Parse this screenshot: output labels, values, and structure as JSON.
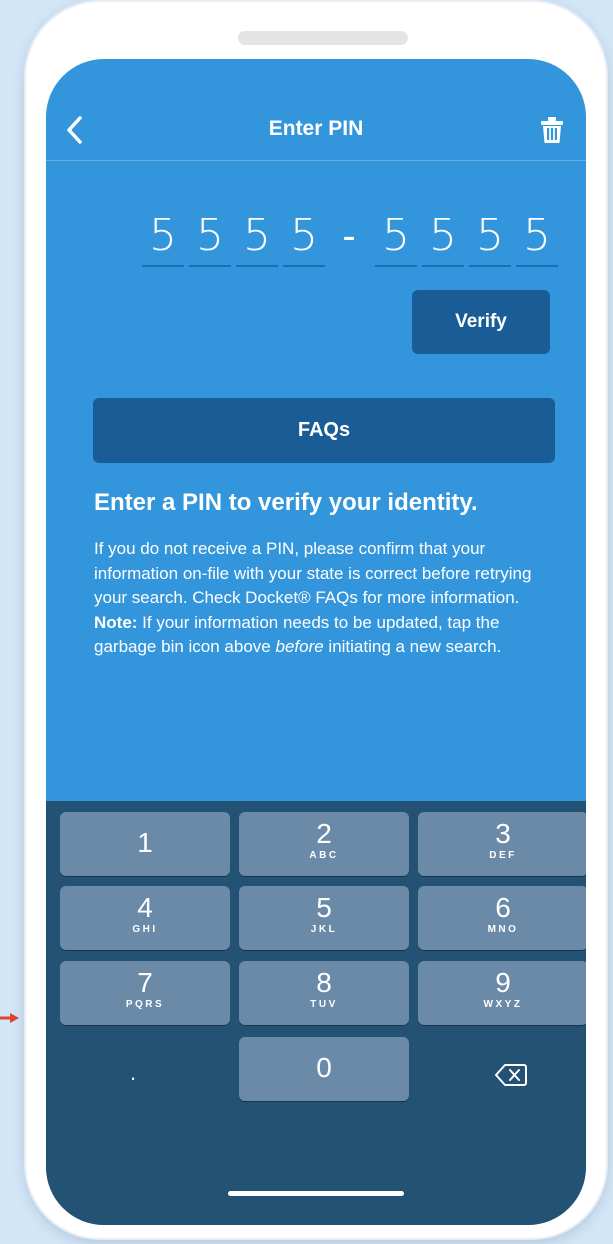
{
  "header": {
    "title": "Enter PIN",
    "back_icon": "chevron-left-icon",
    "trash_icon": "trash-icon"
  },
  "pin": {
    "digits": [
      "5",
      "5",
      "5",
      "5",
      "5",
      "5",
      "5",
      "5"
    ],
    "separator": "-"
  },
  "verify_label": "Verify",
  "faq_label": "FAQs",
  "info": {
    "heading": "Enter a PIN to verify your identity.",
    "text_1": "If you do not receive a PIN, please confirm that your information on-file with your state is correct before retrying your search. Check Docket® FAQs for more information. ",
    "note_label": "Note:",
    "text_2": " If your information needs to be updated, tap the garbage bin icon above ",
    "emphasis": "before",
    "text_3": " initiating a new search."
  },
  "keypad": {
    "keys": [
      {
        "num": "1",
        "letters": ""
      },
      {
        "num": "2",
        "letters": "ABC"
      },
      {
        "num": "3",
        "letters": "DEF"
      },
      {
        "num": "4",
        "letters": "GHI"
      },
      {
        "num": "5",
        "letters": "JKL"
      },
      {
        "num": "6",
        "letters": "MNO"
      },
      {
        "num": "7",
        "letters": "PQRS"
      },
      {
        "num": "8",
        "letters": "TUV"
      },
      {
        "num": "9",
        "letters": "WXYZ"
      },
      {
        "num": "0",
        "letters": ""
      }
    ],
    "decimal_label": ".",
    "backspace_icon": "backspace-icon"
  },
  "colors": {
    "screen_bg": "#3396dc",
    "button_bg": "#1a5c95",
    "keypad_bg": "#245275",
    "key_bg": "#6a8aa7",
    "page_bg": "#d2e6f6",
    "arrow": "#e0452b"
  }
}
